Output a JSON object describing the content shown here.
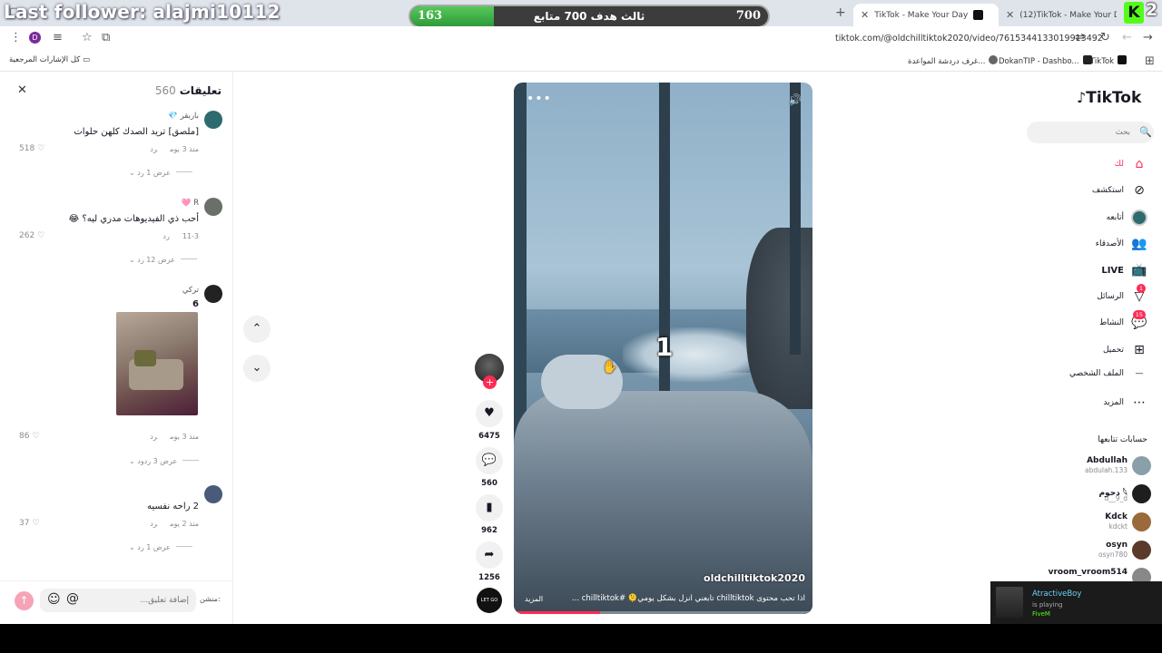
{
  "overlay": {
    "last_follower": "Last follower: alajmi10112",
    "goal": {
      "current": "163",
      "target": "700",
      "label": "ثالث هدف 700 متابع",
      "progress": 0.233
    },
    "kick_count": "2"
  },
  "browser": {
    "tabs": [
      {
        "title": "TikTok - Make Your Day",
        "active": true
      },
      {
        "title": "(12)TikTok - Make Your Day",
        "active": false
      }
    ],
    "url": "tiktok.com/@oldchilltiktok2020/video/7615344133019913492",
    "profile_initial": "D",
    "bookmarks": [
      {
        "label": "TikTok",
        "color": "#111111"
      },
      {
        "label": "DokanTIP - Dashbo...",
        "color": "#222222"
      },
      {
        "label": "غرف دردشة المواعدة...",
        "color": "#666666"
      }
    ],
    "all_bookmarks": "كل الإشارات المرجعية"
  },
  "comments": {
    "title": "تعليقات",
    "count": "560",
    "items": [
      {
        "user": "باربقر 💎",
        "text": "[ملصق] تريد الصدك كلهن حلوات",
        "time": "منذ 3 يوم",
        "reply": "رد",
        "likes": "518",
        "more": "عرض 1 رد",
        "avatar_color": "#2d6b6e"
      },
      {
        "user": "R 🩷",
        "text": "أحب ذي الفيديوهات مدري ليه؟ 😂",
        "time": "11-3",
        "reply": "رد",
        "likes": "262",
        "more": "عرض 12 رد",
        "avatar_color": "#6a6f6a"
      },
      {
        "user": "تركي",
        "text": "6",
        "time": "منذ 3 يوم",
        "reply": "رد",
        "likes": "86",
        "more": "عرض 3 ردود",
        "avatar_color": "#222222"
      },
      {
        "user": "",
        "text": "2 راحه نفسيه",
        "time": "منذ 2 يوم",
        "reply": "رد",
        "likes": "37",
        "more": "عرض 1 رد",
        "avatar_color": "#4a5a7a"
      }
    ],
    "input_placeholder": "إضافة تعليق...",
    "side_label": "منشن:"
  },
  "video": {
    "overlay_number": "1",
    "author": "oldchilltiktok2020",
    "caption": "اذا تحب محتوى chilltiktok تابعني انزل بشكل يومي🫠 #chilltiktok ...",
    "more": "المزيد",
    "progress": 0.29
  },
  "actions": {
    "likes": "6475",
    "comments": "560",
    "saves": "962",
    "shares": "1256",
    "music_label": "LET GO"
  },
  "sidebar": {
    "logo": "TikTok",
    "search_placeholder": "بحث",
    "nav": [
      {
        "label": "لك",
        "icon": "home-icon"
      },
      {
        "label": "استكشف",
        "icon": "compass-icon"
      },
      {
        "label": "أتابعه",
        "icon": "following-icon"
      },
      {
        "label": "الأصدقاء",
        "icon": "friends-icon"
      },
      {
        "label": "LIVE",
        "icon": "live-icon"
      },
      {
        "label": "الرسائل",
        "icon": "messages-icon",
        "badge": "1"
      },
      {
        "label": "النشاط",
        "icon": "activity-icon",
        "badge": "15"
      },
      {
        "label": "تحميل",
        "icon": "upload-icon"
      },
      {
        "label": "الملف الشخصي",
        "icon": "profile-icon"
      },
      {
        "label": "المزيد",
        "icon": "more-icon"
      }
    ],
    "following_header": "حسابات تتابعها",
    "following": [
      {
        "name": "Abdullah",
        "handle": "abdulah.133",
        "color": "#8aa0a8"
      },
      {
        "name": "دحوم 𓆩",
        "handle": "d__9_d",
        "color": "#1e1e1e"
      },
      {
        "name": "Kdck",
        "handle": "kdckt",
        "color": "#9a6a3a"
      },
      {
        "name": "osyn",
        "handle": "osyn780",
        "color": "#5a3a2a"
      },
      {
        "name": "vroom_vroom514",
        "handle": "",
        "color": "#888888"
      }
    ]
  },
  "stream_notification": {
    "name": "AtractiveBoy",
    "status": "is playing",
    "game": "FiveM"
  },
  "colors": {
    "accent": "#fe2c55",
    "goal_green": "#3fb24a",
    "kick": "#53fc18"
  }
}
